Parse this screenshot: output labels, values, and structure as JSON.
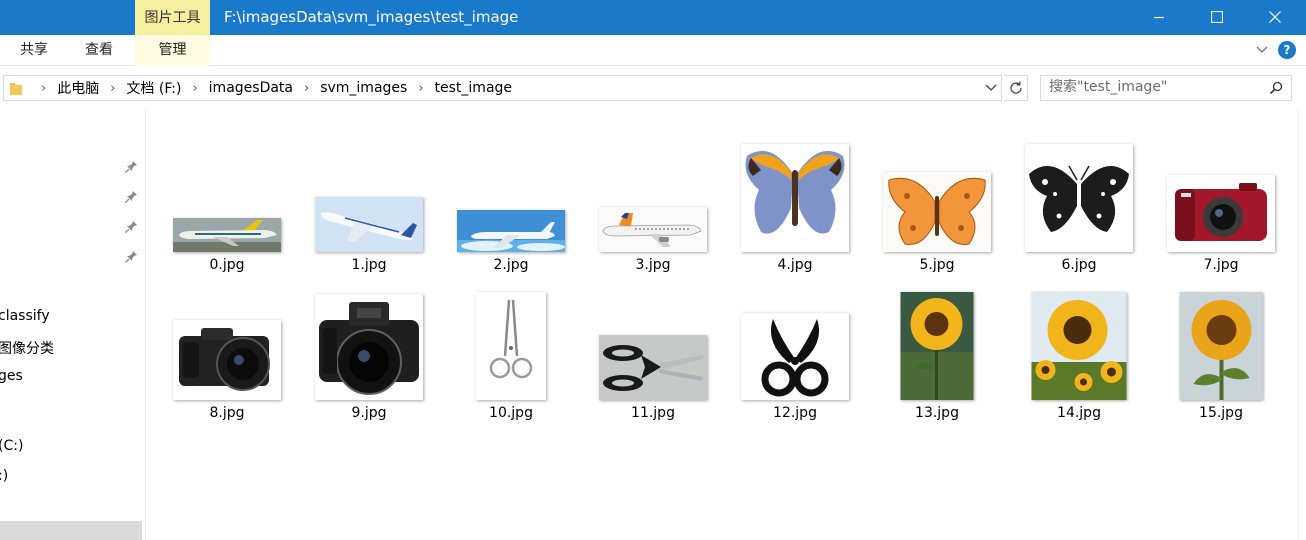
{
  "titlebar": {
    "context_tab": "图片工具",
    "path": "F:\\imagesData\\svm_images\\test_image"
  },
  "ribbon": {
    "tabs": [
      "共享",
      "查看",
      "管理"
    ]
  },
  "address": {
    "crumbs": [
      "此电脑",
      "文档 (F:)",
      "imagesData",
      "svm_images",
      "test_image"
    ]
  },
  "search": {
    "placeholder": "搜索\"test_image\""
  },
  "nav": {
    "items": [
      "classify",
      "图像分类",
      "ges",
      "(C:)",
      ":)"
    ]
  },
  "files": [
    {
      "name": "0.jpg",
      "kind": "airplane"
    },
    {
      "name": "1.jpg",
      "kind": "airplane"
    },
    {
      "name": "2.jpg",
      "kind": "airplane"
    },
    {
      "name": "3.jpg",
      "kind": "airplane"
    },
    {
      "name": "4.jpg",
      "kind": "butterfly"
    },
    {
      "name": "5.jpg",
      "kind": "butterfly"
    },
    {
      "name": "6.jpg",
      "kind": "butterfly"
    },
    {
      "name": "7.jpg",
      "kind": "camera"
    },
    {
      "name": "8.jpg",
      "kind": "camera"
    },
    {
      "name": "9.jpg",
      "kind": "camera"
    },
    {
      "name": "10.jpg",
      "kind": "scissors"
    },
    {
      "name": "11.jpg",
      "kind": "scissors"
    },
    {
      "name": "12.jpg",
      "kind": "scissors"
    },
    {
      "name": "13.jpg",
      "kind": "sunflower"
    },
    {
      "name": "14.jpg",
      "kind": "sunflower"
    },
    {
      "name": "15.jpg",
      "kind": "sunflower"
    }
  ],
  "colors": {
    "titlebar": "#1979ca",
    "context_tab": "#f5f0a0",
    "selection": "#d9d9d9"
  }
}
